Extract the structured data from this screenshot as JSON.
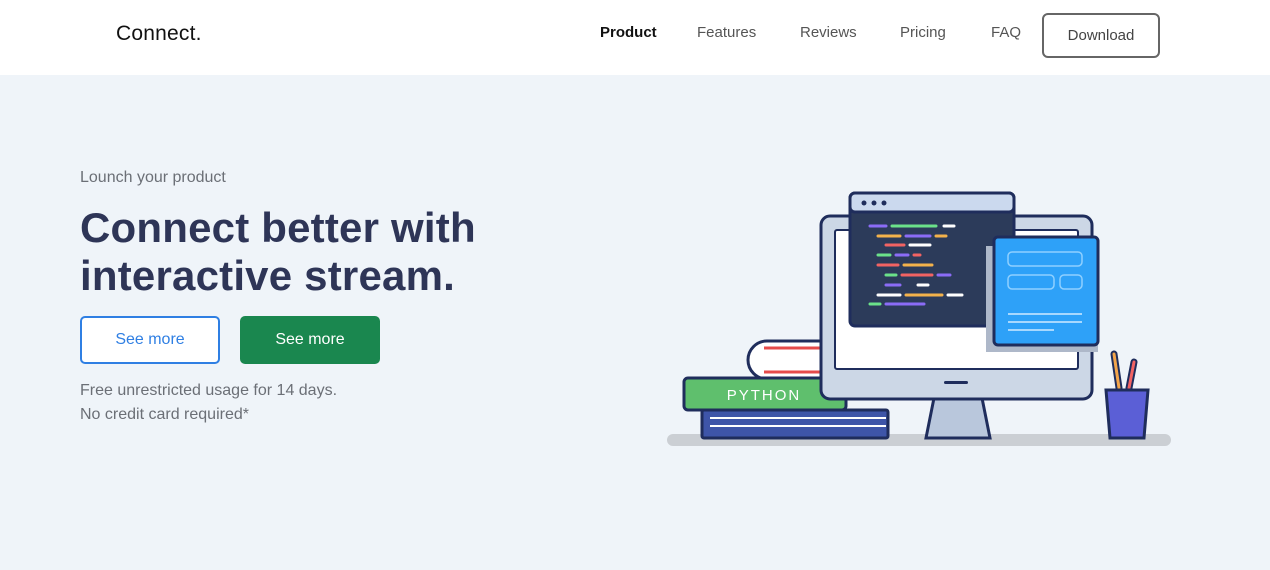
{
  "header": {
    "logo": "Connect.",
    "nav": [
      "Product",
      "Features",
      "Reviews",
      "Pricing",
      "FAQ"
    ],
    "download_label": "Download"
  },
  "hero": {
    "eyebrow": "Lounch your product",
    "headline_line1": "Connect better with",
    "headline_line2": "interactive stream.",
    "cta_outline": "See more",
    "cta_solid": "See more",
    "note_line1": "Free unrestricted usage for 14 days.",
    "note_line2": "No credit card required*"
  },
  "illustration": {
    "book_label": "PYTHON",
    "colors": {
      "outline": "#1f2d5c",
      "screen_dark": "#2c3b5a",
      "panel_blue": "#2ea1f8",
      "book_green": "#5fbf6d",
      "cup": "#5b5fd6"
    }
  },
  "colors": {
    "page_bg": "#eff4f9",
    "headline": "#2e3557",
    "accent_blue": "#2f7fe3",
    "accent_green": "#1a874f"
  }
}
